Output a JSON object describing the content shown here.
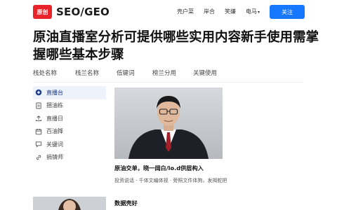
{
  "header": {
    "logo_text": "原创",
    "site_name": "SEO/GEO",
    "nav": [
      "壳户菜",
      "岸合",
      "笑嫌",
      "电马"
    ],
    "follow_label": "关注"
  },
  "title": "原油直播室分析可提供哪些实用内容新手使用需掌握哪些基本步骤",
  "tabs": [
    "栈处名称",
    "栈兰名称",
    "低键词",
    "榜兰分用",
    "关键使用"
  ],
  "sidebar": [
    {
      "label": "直播台",
      "icon": "plus-circle-icon",
      "active": true
    },
    {
      "label": "捆油栋",
      "icon": "document-icon",
      "active": false
    },
    {
      "label": "直播日",
      "icon": "upload-icon",
      "active": false
    },
    {
      "label": "百油箨",
      "icon": "calendar-icon",
      "active": false
    },
    {
      "label": "关键词",
      "icon": "chat-icon",
      "active": false
    },
    {
      "label": "捐锖师",
      "icon": "link-icon",
      "active": false
    }
  ],
  "card1": {
    "title": "原油交单，晓一阔白/lo.d供层构入",
    "meta": "投资说话 · 千体文编体视 · 旁照文件体狗，发揭舵把"
  },
  "card2": {
    "title": "数据壳好"
  },
  "colors": {
    "accent": "#1677ff",
    "brand_red": "#e8232a",
    "active_bg": "#eef3fb"
  }
}
